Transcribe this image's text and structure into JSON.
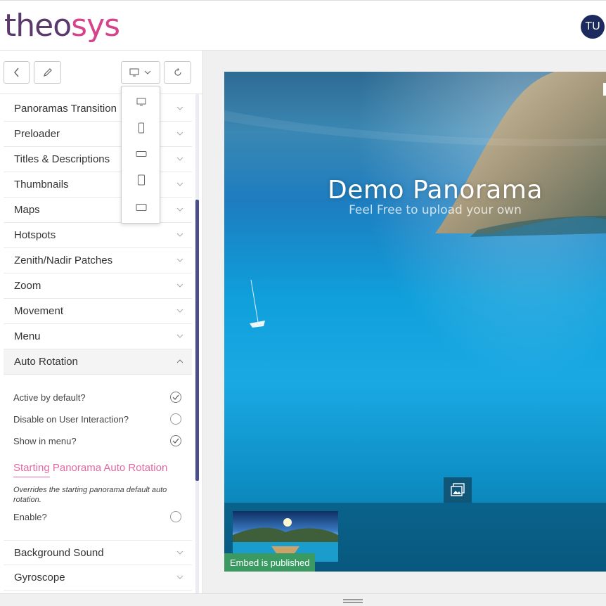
{
  "app": {
    "logo_part1": "theo",
    "logo_part2": "sys",
    "user_initials": "TU"
  },
  "toolbar": {
    "back_icon": "chevron-left-icon",
    "edit_icon": "pencil-icon",
    "device_icon": "monitor-icon",
    "refresh_icon": "refresh-icon"
  },
  "device_menu": [
    "desktop-icon",
    "phone-portrait-icon",
    "phone-landscape-icon",
    "tablet-portrait-icon",
    "tablet-landscape-icon"
  ],
  "accordion": [
    {
      "label": "Panoramas Transition"
    },
    {
      "label": "Preloader"
    },
    {
      "label": "Titles & Descriptions"
    },
    {
      "label": "Thumbnails"
    },
    {
      "label": "Maps"
    },
    {
      "label": "Hotspots"
    },
    {
      "label": "Zenith/Nadir Patches"
    },
    {
      "label": "Zoom"
    },
    {
      "label": "Movement"
    },
    {
      "label": "Menu"
    },
    {
      "label": "Auto Rotation"
    },
    {
      "label": "Background Sound"
    },
    {
      "label": "Gyroscope"
    }
  ],
  "auto_rotation": {
    "options": [
      {
        "label": "Active by default?",
        "checked": true
      },
      {
        "label": "Disable on User Interaction?",
        "checked": false
      },
      {
        "label": "Show in menu?",
        "checked": true
      }
    ],
    "section_title": "Starting Panorama Auto Rotation",
    "section_note": "Overrides the starting panorama default auto rotation.",
    "enable_label": "Enable?",
    "enable_checked": false
  },
  "preview": {
    "title": "Demo Panorama",
    "subtitle": "Feel Free to upload your own",
    "status": "Embed is published",
    "gallery_icon": "gallery-icon"
  },
  "colors": {
    "brand_dark": "#5a3a6a",
    "brand_pink": "#d6428c",
    "avatar_bg": "#1c2a5e",
    "accent_pink": "#e06aa2",
    "published_green": "#3a9a62",
    "scrollbar": "#4b4e8c"
  }
}
